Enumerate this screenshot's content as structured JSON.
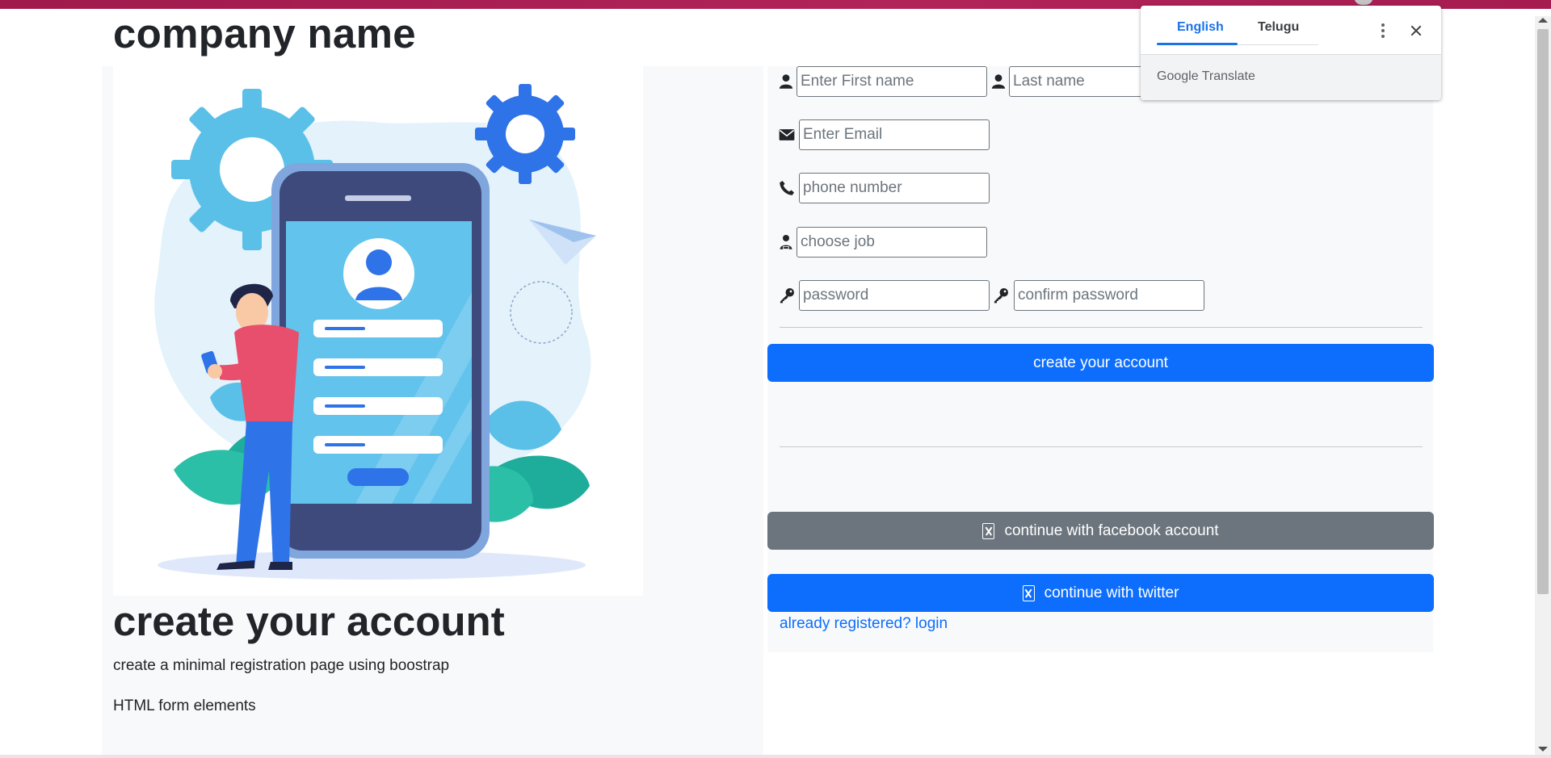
{
  "page": {
    "brand": "company name",
    "heading": "create your account",
    "description": "create a minimal registration page using boostrap",
    "subtext": "HTML form elements"
  },
  "form": {
    "first_name_placeholder": "Enter First name",
    "last_name_placeholder": "Last name",
    "email_placeholder": "Enter Email",
    "phone_placeholder": "phone number",
    "job_placeholder": "choose job",
    "password_placeholder": "password",
    "confirm_password_placeholder": "confirm password",
    "submit_label": "create your account",
    "facebook_label": "continue with facebook account",
    "twitter_label": "continue with twitter",
    "login_link": "already registered? login"
  },
  "translate": {
    "tab_source": "English",
    "tab_target": "Telugu",
    "brand": "Google Translate"
  },
  "colors": {
    "primary": "#0d6efd",
    "secondary": "#6c757d",
    "topbar": "#a51c50",
    "panel": "#f8f9fa"
  },
  "icons": [
    "user-icon",
    "envelope-icon",
    "phone-icon",
    "job-icon",
    "key-icon",
    "facebook-icon",
    "twitter-icon",
    "more-vert-icon",
    "close-icon"
  ]
}
